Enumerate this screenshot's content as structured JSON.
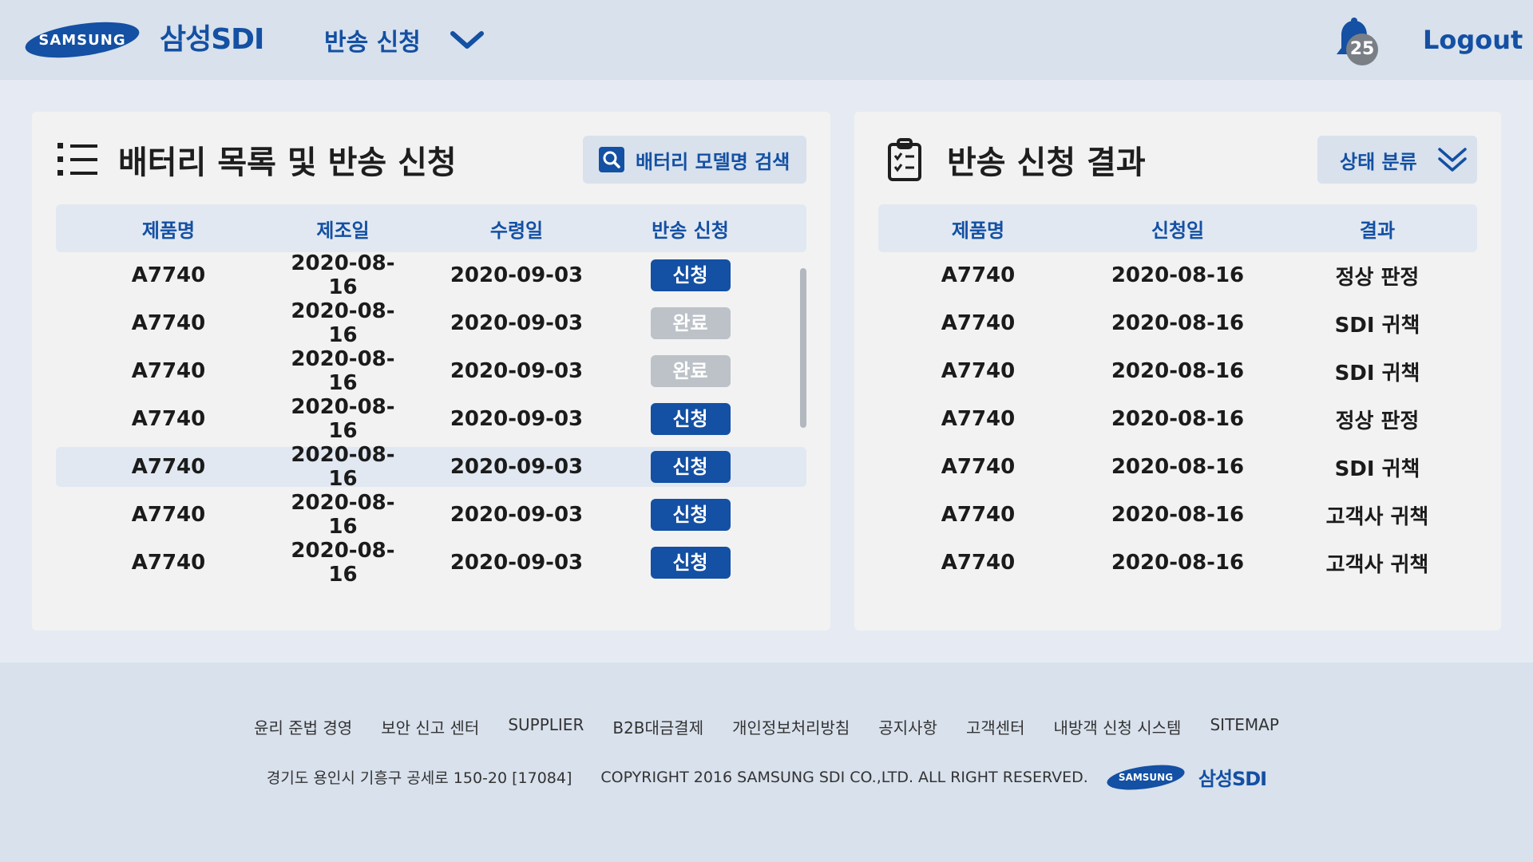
{
  "header": {
    "logo_text": "SAMSUNG",
    "brand": "삼성SDI",
    "nav_label": "반송 신청",
    "notification_count": "25",
    "logout_label": "Logout"
  },
  "left_panel": {
    "title": "배터리 목록 및 반송 신청",
    "search_label": "배터리 모델명 검색",
    "columns": [
      "제품명",
      "제조일",
      "수령일",
      "반송 신청"
    ],
    "rows": [
      {
        "product": "A7740",
        "manufactured": "2020-08-16",
        "received": "2020-09-03",
        "action": "신청",
        "status": "apply"
      },
      {
        "product": "A7740",
        "manufactured": "2020-08-16",
        "received": "2020-09-03",
        "action": "완료",
        "status": "done"
      },
      {
        "product": "A7740",
        "manufactured": "2020-08-16",
        "received": "2020-09-03",
        "action": "완료",
        "status": "done"
      },
      {
        "product": "A7740",
        "manufactured": "2020-08-16",
        "received": "2020-09-03",
        "action": "신청",
        "status": "apply"
      },
      {
        "product": "A7740",
        "manufactured": "2020-08-16",
        "received": "2020-09-03",
        "action": "신청",
        "status": "apply"
      },
      {
        "product": "A7740",
        "manufactured": "2020-08-16",
        "received": "2020-09-03",
        "action": "신청",
        "status": "apply"
      },
      {
        "product": "A7740",
        "manufactured": "2020-08-16",
        "received": "2020-09-03",
        "action": "신청",
        "status": "apply"
      }
    ]
  },
  "right_panel": {
    "title": "반송 신청 결과",
    "filter_label": "상태 분류",
    "columns": [
      "제품명",
      "신청일",
      "결과"
    ],
    "rows": [
      {
        "product": "A7740",
        "applied": "2020-08-16",
        "result": "정상 판정"
      },
      {
        "product": "A7740",
        "applied": "2020-08-16",
        "result": "SDI 귀책"
      },
      {
        "product": "A7740",
        "applied": "2020-08-16",
        "result": "SDI 귀책"
      },
      {
        "product": "A7740",
        "applied": "2020-08-16",
        "result": "정상 판정"
      },
      {
        "product": "A7740",
        "applied": "2020-08-16",
        "result": "SDI 귀책"
      },
      {
        "product": "A7740",
        "applied": "2020-08-16",
        "result": "고객사 귀책"
      },
      {
        "product": "A7740",
        "applied": "2020-08-16",
        "result": "고객사 귀책"
      }
    ]
  },
  "footer": {
    "links": [
      "윤리 준법 경영",
      "보안 신고 센터",
      "SUPPLIER",
      "B2B대금결제",
      "개인정보처리방침",
      "공지사항",
      "고객센터",
      "내방객 신청 시스템",
      "SITEMAP"
    ],
    "address": "경기도 용인시 기흥구 공세로 150-20 [17084]",
    "copyright": "COPYRIGHT 2016 SAMSUNG SDI CO.,LTD. ALL RIGHT RESERVED.",
    "logo_text": "SAMSUNG",
    "brand": "삼성SDI"
  },
  "colors": {
    "primary": "#1450a3",
    "header_bg": "#d8e1ec",
    "page_bg": "#e6ebf3",
    "panel_bg": "#f2f2f2",
    "done_pill": "#bcc2c8"
  },
  "icons": {
    "nav": "chevron-down-icon",
    "notifications": "bell-icon",
    "left_title": "list-icon",
    "search": "search-icon",
    "right_title": "clipboard-icon",
    "filter": "double-chevron-down-icon"
  }
}
